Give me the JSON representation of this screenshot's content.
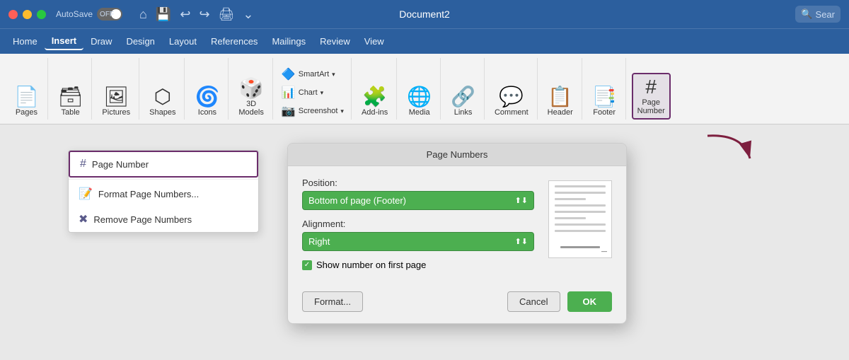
{
  "titlebar": {
    "title": "Document2",
    "autosave_label": "AutoSave",
    "autosave_state": "OFF",
    "search_placeholder": "Sear"
  },
  "menubar": {
    "items": [
      {
        "label": "Home",
        "active": false
      },
      {
        "label": "Insert",
        "active": true
      },
      {
        "label": "Draw",
        "active": false
      },
      {
        "label": "Design",
        "active": false
      },
      {
        "label": "Layout",
        "active": false
      },
      {
        "label": "References",
        "active": false
      },
      {
        "label": "Mailings",
        "active": false
      },
      {
        "label": "Review",
        "active": false
      },
      {
        "label": "View",
        "active": false
      }
    ]
  },
  "ribbon": {
    "groups": [
      {
        "name": "pages",
        "label": "Pages"
      },
      {
        "name": "table",
        "label": "Table"
      },
      {
        "name": "pictures",
        "label": "Pictures"
      },
      {
        "name": "shapes",
        "label": "Shapes"
      },
      {
        "name": "icons",
        "label": "Icons"
      },
      {
        "name": "3d-models",
        "label": "3D Models"
      },
      {
        "name": "smartart",
        "label": "SmartArt"
      },
      {
        "name": "chart",
        "label": "Chart"
      },
      {
        "name": "screenshot",
        "label": "Screenshot"
      },
      {
        "name": "add-ins",
        "label": "Add-ins"
      },
      {
        "name": "media",
        "label": "Media"
      },
      {
        "name": "links",
        "label": "Links"
      },
      {
        "name": "comment",
        "label": "Comment"
      },
      {
        "name": "header",
        "label": "Header"
      },
      {
        "name": "footer",
        "label": "Footer"
      },
      {
        "name": "page-number",
        "label": "Page\nNumber"
      }
    ]
  },
  "dropdown": {
    "items": [
      {
        "label": "Page Number",
        "highlighted": true
      },
      {
        "label": "Format Page Numbers...",
        "highlighted": false
      },
      {
        "label": "Remove Page Numbers",
        "highlighted": false
      }
    ]
  },
  "dialog": {
    "title": "Page Numbers",
    "position_label": "Position:",
    "position_value": "Bottom of page (Footer)",
    "alignment_label": "Alignment:",
    "alignment_value": "Right",
    "checkbox_label": "Show number on first page",
    "checkbox_checked": true,
    "btn_format": "Format...",
    "btn_cancel": "Cancel",
    "btn_ok": "OK"
  }
}
